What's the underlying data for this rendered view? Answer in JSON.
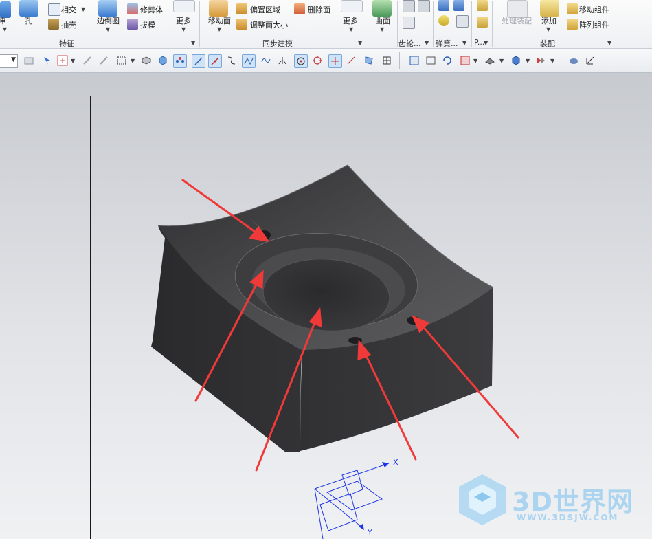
{
  "ribbon": {
    "groups": [
      {
        "label": "特征"
      },
      {
        "label": "同步建模"
      },
      {
        "label": "齿轮..."
      },
      {
        "label": "弹簧..."
      },
      {
        "label": "P..."
      },
      {
        "label": "装配"
      }
    ],
    "feature": {
      "extrude_label": "拉伸",
      "hole_label": "孔",
      "intersect_label": "相交",
      "shell_label": "抽壳",
      "edge_blend_label": "边倒圆",
      "trim_body_label": "修剪体",
      "draft_label": "拔模",
      "more_label": "更多"
    },
    "sync": {
      "move_face_label": "移动面",
      "offset_region_label": "偏置区域",
      "resize_face_label": "调整面大小",
      "delete_face_label": "删除面",
      "more_label": "更多"
    },
    "surface": {
      "label": "曲面"
    },
    "assembly": {
      "process_label": "处理装配",
      "add_label": "添加",
      "move_component_label": "移动组件",
      "array_component_label": "阵列组件"
    }
  },
  "viewport": {
    "axis_x_label": "X",
    "axis_y_label": "Y"
  },
  "watermark": {
    "brand": "3D世界网",
    "url": "WWW.3DSJW.COM"
  },
  "colors": {
    "model": "#3a3a3c",
    "arrow": "#f03a3a",
    "axis": "#1c34e8",
    "viewport_top": "#c7cacf",
    "viewport_bottom": "#f0f1f3"
  }
}
